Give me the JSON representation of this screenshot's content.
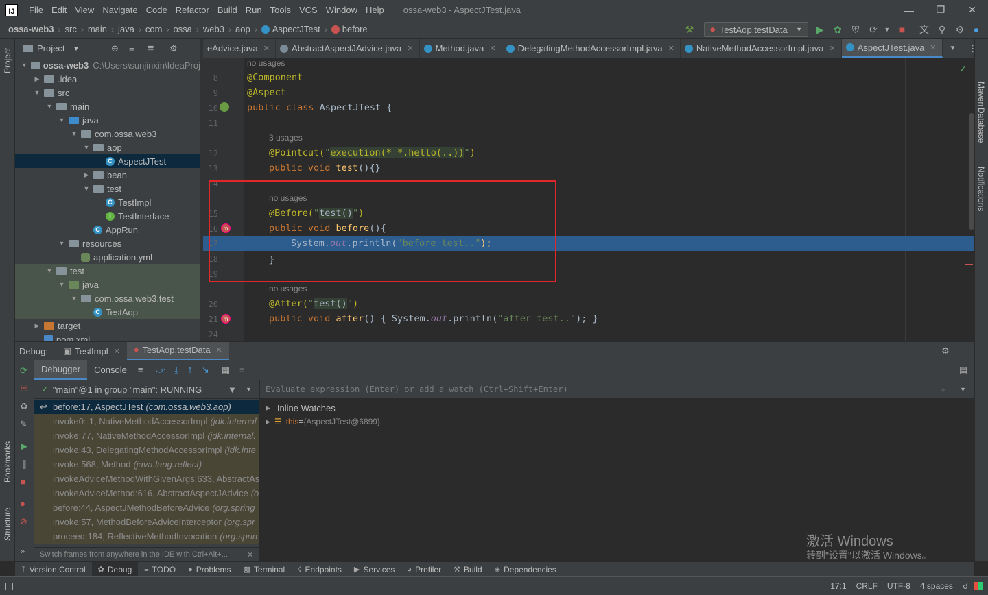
{
  "menubar": {
    "logo": "IJ",
    "items": [
      "File",
      "Edit",
      "View",
      "Navigate",
      "Code",
      "Refactor",
      "Build",
      "Run",
      "Tools",
      "VCS",
      "Window",
      "Help"
    ],
    "title": "ossa-web3 - AspectJTest.java"
  },
  "navbar": {
    "crumbs": [
      "ossa-web3",
      "src",
      "main",
      "java",
      "com",
      "ossa",
      "web3",
      "aop",
      "AspectJTest",
      "before"
    ],
    "run_config": "TestAop.testData"
  },
  "left_strip": {
    "project": "Project",
    "bookmarks": "Bookmarks",
    "structure": "Structure"
  },
  "right_strip": {
    "maven": "Maven",
    "database": "Database",
    "notifications": "Notifications"
  },
  "project": {
    "title": "Project",
    "root_path": "C:\\Users\\sunjinxin\\IdeaProj",
    "tree": [
      {
        "label": "ossa-web3",
        "depth": 0,
        "arrow": "down",
        "icon": "folder"
      },
      {
        "label": ".idea",
        "depth": 1,
        "arrow": "right",
        "icon": "folder"
      },
      {
        "label": "src",
        "depth": 1,
        "arrow": "down",
        "icon": "folder"
      },
      {
        "label": "main",
        "depth": 2,
        "arrow": "down",
        "icon": "folder"
      },
      {
        "label": "java",
        "depth": 3,
        "arrow": "down",
        "icon": "blue"
      },
      {
        "label": "com.ossa.web3",
        "depth": 4,
        "arrow": "down",
        "icon": "folder"
      },
      {
        "label": "aop",
        "depth": 5,
        "arrow": "down",
        "icon": "folder"
      },
      {
        "label": "AspectJTest",
        "depth": 6,
        "arrow": "",
        "icon": "class"
      },
      {
        "label": "bean",
        "depth": 5,
        "arrow": "right",
        "icon": "folder"
      },
      {
        "label": "test",
        "depth": 5,
        "arrow": "down",
        "icon": "folder"
      },
      {
        "label": "TestImpl",
        "depth": 6,
        "arrow": "",
        "icon": "class"
      },
      {
        "label": "TestInterface",
        "depth": 6,
        "arrow": "",
        "icon": "iface"
      },
      {
        "label": "AppRun",
        "depth": 5,
        "arrow": "",
        "icon": "class"
      },
      {
        "label": "resources",
        "depth": 3,
        "arrow": "down",
        "icon": "folder"
      },
      {
        "label": "application.yml",
        "depth": 4,
        "arrow": "",
        "icon": "yml"
      },
      {
        "label": "test",
        "depth": 2,
        "arrow": "down",
        "icon": "folder"
      },
      {
        "label": "java",
        "depth": 3,
        "arrow": "down",
        "icon": "green"
      },
      {
        "label": "com.ossa.web3.test",
        "depth": 4,
        "arrow": "down",
        "icon": "folder"
      },
      {
        "label": "TestAop",
        "depth": 5,
        "arrow": "",
        "icon": "class"
      },
      {
        "label": "target",
        "depth": 1,
        "arrow": "right",
        "icon": "orange"
      },
      {
        "label": "pom.xml",
        "depth": 1,
        "arrow": "",
        "icon": "xml"
      }
    ]
  },
  "editor_tabs": [
    {
      "label": "eAdvice.java",
      "icon": "none"
    },
    {
      "label": "AbstractAspectJAdvice.java",
      "icon": "abstract"
    },
    {
      "label": "Method.java",
      "icon": "class"
    },
    {
      "label": "DelegatingMethodAccessorImpl.java",
      "icon": "class"
    },
    {
      "label": "NativeMethodAccessorImpl.java",
      "icon": "class"
    },
    {
      "label": "AspectJTest.java",
      "icon": "class",
      "active": true
    }
  ],
  "code": {
    "line_numbers": [
      "8",
      "9",
      "10",
      "11",
      "12",
      "13",
      "14",
      "15",
      "16",
      "17",
      "18",
      "19",
      "20",
      "21",
      "24"
    ],
    "hints": {
      "h0": "no usages",
      "h1": "3 usages",
      "h2": "no usages",
      "h3": "no usages"
    },
    "l8": "@Component",
    "l9": "@Aspect",
    "l10_kw": "public class ",
    "l10_name": "AspectJTest {",
    "l12_ann": "@Pointcut(",
    "l12_str1": "\"",
    "l12_exec": "execution(* *.hello(..))",
    "l12_str2": "\"",
    "l12_end": ")",
    "l13_kw": "public void ",
    "l13_fn": "test",
    "l13_end": "(){}",
    "l15_ann": "@Before(",
    "l15_q1": "\"",
    "l15_arg": "test()",
    "l15_q2": "\"",
    "l15_end": ")",
    "l16_kw": "public void ",
    "l16_fn": "before",
    "l16_end": "(){",
    "l17_a": "System.",
    "l17_out": "out",
    "l17_b": ".println(",
    "l17_str": "\"before test..\"",
    "l17_end": ");",
    "l18": "}",
    "l20_ann": "@After(",
    "l20_q1": "\"",
    "l20_arg": "test()",
    "l20_q2": "\"",
    "l20_end": ")",
    "l21_kw": "public void ",
    "l21_fn": "after",
    "l21_mid": "() { System.",
    "l21_out": "out",
    "l21_b": ".println(",
    "l21_str": "\"after test..\"",
    "l21_end": "); }"
  },
  "debug": {
    "label": "Debug:",
    "tabs": [
      {
        "label": "TestImpl"
      },
      {
        "label": "TestAop.testData",
        "active": true
      }
    ],
    "subtabs": {
      "debugger": "Debugger",
      "console": "Console"
    },
    "thread": "\"main\"@1 in group \"main\": RUNNING",
    "eval_placeholder": "Evaluate expression (Enter) or add a watch (Ctrl+Shift+Enter)",
    "frames": [
      {
        "method": "before:17, AspectJTest",
        "cls": "(com.ossa.web3.aop)",
        "current": true
      },
      {
        "method": "invoke0:-1, NativeMethodAccessorImpl",
        "cls": "(jdk.internal"
      },
      {
        "method": "invoke:77, NativeMethodAccessorImpl",
        "cls": "(jdk.internal."
      },
      {
        "method": "invoke:43, DelegatingMethodAccessorImpl",
        "cls": "(jdk.inte"
      },
      {
        "method": "invoke:568, Method",
        "cls": "(java.lang.reflect)"
      },
      {
        "method": "invokeAdviceMethodWithGivenArgs:633, AbstractAs",
        "cls": ""
      },
      {
        "method": "invokeAdviceMethod:616, AbstractAspectJAdvice",
        "cls": "(o"
      },
      {
        "method": "before:44, AspectJMethodBeforeAdvice",
        "cls": "(org.spring"
      },
      {
        "method": "invoke:57, MethodBeforeAdviceInterceptor",
        "cls": "(org.spr"
      },
      {
        "method": "proceed:184, ReflectiveMethodInvocation",
        "cls": "(org.sprin"
      }
    ],
    "frames_hint": "Switch frames from anywhere in the IDE with Ctrl+Alt+...",
    "inline_watches": "Inline Watches",
    "var_name": "this",
    "var_eq": " = ",
    "var_val": "{AspectJTest@6899}"
  },
  "bottom_tools": [
    "Version Control",
    "Debug",
    "TODO",
    "Problems",
    "Terminal",
    "Endpoints",
    "Services",
    "Profiler",
    "Build",
    "Dependencies"
  ],
  "status": {
    "pos": "17:1",
    "eol": "CRLF",
    "enc": "UTF-8",
    "indent": "4 spaces"
  },
  "watermark": {
    "line1": "激活 Windows",
    "line2": "转到\"设置\"以激活 Windows。"
  }
}
